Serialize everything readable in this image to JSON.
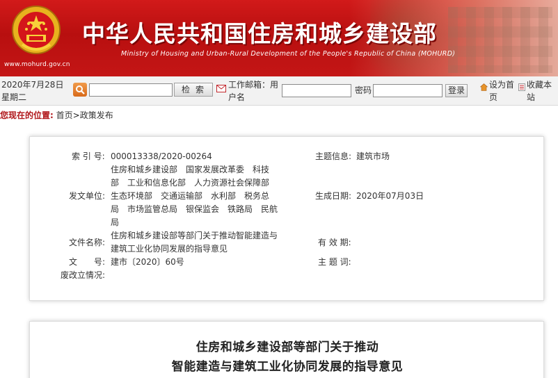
{
  "banner": {
    "url": "www.mohurd.gov.cn",
    "title_cn": "中华人民共和国住房和城乡建设部",
    "title_en": "Ministry of Housing and Urban-Rural Development of the People's Republic of China (MOHURD)",
    "emblem_icon": "national-emblem-icon"
  },
  "toolbar": {
    "date": "2020年7月28日 星期二",
    "search_placeholder": "",
    "search_label": "检索",
    "mail_label": "工作邮箱：用户名",
    "username_value": "",
    "password_label": "密码",
    "password_value": "",
    "login_label": "登录",
    "set_home_label": "设为首页",
    "favorite_label": "收藏本站"
  },
  "location": {
    "label": "您现在的位置:",
    "home": "首页",
    "separator": ">",
    "current": "政策发布"
  },
  "meta": {
    "index_label": "索 引 号:",
    "index_value": "000013338/2020-00264",
    "topic_label": "主题信息:",
    "topic_value": "建筑市场",
    "issuer_label": "发文单位:",
    "issuer_lines": [
      "住房和城乡建设部　国家发展改革委　科技",
      "部　工业和信息化部　人力资源社会保障部",
      "生态环境部　交通运输部　水利部　税务总",
      "局　市场监管总局　银保监会　铁路局　民航",
      "局"
    ],
    "date_label": "生成日期:",
    "date_value": "2020年07月03日",
    "name_label": "文件名称:",
    "name_lines": [
      "住房和城乡建设部等部门关于推动智能建造与",
      "建筑工业化协同发展的指导意见"
    ],
    "validity_label": "有 效 期:",
    "validity_value": "",
    "docno_label": "文　　号:",
    "docno_value": "建市〔2020〕60号",
    "keywords_label": "主 题 词:",
    "keywords_value": "",
    "revision_label": "废改立情况:",
    "revision_value": ""
  },
  "article": {
    "title_line1": "住房和城乡建设部等部门关于推动",
    "title_line2": "智能建造与建筑工业化协同发展的指导意见"
  },
  "colors": {
    "banner_red": "#c41616",
    "location_red": "#b0161a",
    "search_orange": "#e07a25"
  }
}
